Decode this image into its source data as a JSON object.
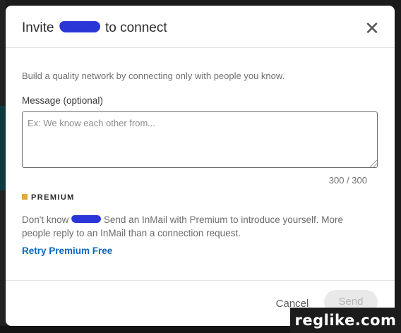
{
  "dialog": {
    "title_prefix": "Invite",
    "title_suffix": "to connect",
    "close_glyph": "✕"
  },
  "intro_text": "Build a quality network by connecting only with people you know.",
  "message": {
    "label": "Message (optional)",
    "placeholder": "Ex: We know each other from...",
    "value": "",
    "counter": "300 / 300"
  },
  "premium": {
    "badge": "PREMIUM",
    "desc_prefix": "Don't know",
    "desc_suffix": "Send an InMail with Premium to introduce yourself. More people reply to an InMail than a connection request.",
    "cta": "Retry Premium Free",
    "accent": "#e2a93b"
  },
  "footer": {
    "cancel_label": "Cancel",
    "send_label": "Send"
  },
  "watermark": "reglike.com",
  "colors": {
    "link": "#0a66c2",
    "redaction": "#2a36d6"
  }
}
